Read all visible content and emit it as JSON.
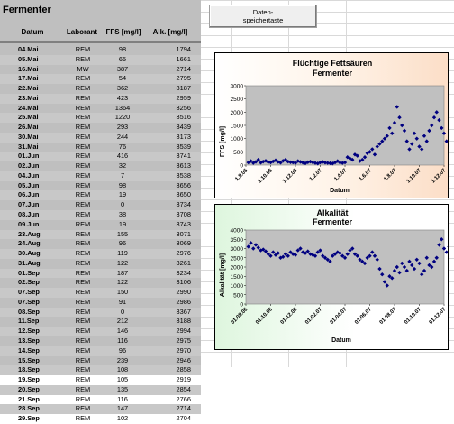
{
  "sheet": {
    "title": "Fermenter",
    "columns": [
      "Datum",
      "Laborant",
      "FFS [mg/l]",
      "Alk. [mg/l]"
    ],
    "rows": [
      [
        "04.Mai",
        "REM",
        "98",
        "1794"
      ],
      [
        "05.Mai",
        "REM",
        "65",
        "1661"
      ],
      [
        "16.Mai",
        "MW",
        "387",
        "2714"
      ],
      [
        "17.Mai",
        "REM",
        "54",
        "2795"
      ],
      [
        "22.Mai",
        "REM",
        "362",
        "3187"
      ],
      [
        "23.Mai",
        "REM",
        "423",
        "2959"
      ],
      [
        "24.Mai",
        "REM",
        "1364",
        "3256"
      ],
      [
        "25.Mai",
        "REM",
        "1220",
        "3516"
      ],
      [
        "26.Mai",
        "REM",
        "293",
        "3439"
      ],
      [
        "30.Mai",
        "REM",
        "244",
        "3173"
      ],
      [
        "31.Mai",
        "REM",
        "76",
        "3539"
      ],
      [
        "01.Jun",
        "REM",
        "416",
        "3741"
      ],
      [
        "02.Jun",
        "REM",
        "32",
        "3613"
      ],
      [
        "04.Jun",
        "REM",
        "7",
        "3538"
      ],
      [
        "05.Jun",
        "REM",
        "98",
        "3656"
      ],
      [
        "06.Jun",
        "REM",
        "19",
        "3650"
      ],
      [
        "07.Jun",
        "REM",
        "0",
        "3734"
      ],
      [
        "08.Jun",
        "REM",
        "38",
        "3708"
      ],
      [
        "09.Jun",
        "REM",
        "19",
        "3743"
      ],
      [
        "23.Aug",
        "REM",
        "155",
        "3071"
      ],
      [
        "24.Aug",
        "REM",
        "96",
        "3069"
      ],
      [
        "30.Aug",
        "REM",
        "119",
        "2976"
      ],
      [
        "31.Aug",
        "REM",
        "122",
        "3261"
      ],
      [
        "01.Sep",
        "REM",
        "187",
        "3234"
      ],
      [
        "02.Sep",
        "REM",
        "122",
        "3106"
      ],
      [
        "07.Sep",
        "REM",
        "150",
        "2990"
      ],
      [
        "07.Sep",
        "REM",
        "91",
        "2986"
      ],
      [
        "08.Sep",
        "REM",
        "0",
        "3367"
      ],
      [
        "11.Sep",
        "REM",
        "212",
        "3188"
      ],
      [
        "12.Sep",
        "REM",
        "146",
        "2994"
      ],
      [
        "13.Sep",
        "REM",
        "116",
        "2975"
      ],
      [
        "14.Sep",
        "REM",
        "96",
        "2970"
      ],
      [
        "15.Sep",
        "REM",
        "239",
        "2946"
      ],
      [
        "18.Sep",
        "REM",
        "108",
        "2858"
      ],
      [
        "19.Sep",
        "REM",
        "105",
        "2919"
      ],
      [
        "20.Sep",
        "REM",
        "135",
        "2854"
      ],
      [
        "21.Sep",
        "REM",
        "116",
        "2766"
      ],
      [
        "28.Sep",
        "REM",
        "147",
        "2714"
      ],
      [
        "29.Sep",
        "REM",
        "102",
        "2704"
      ]
    ]
  },
  "button": {
    "line1": "Daten-",
    "line2": "speichertaste"
  },
  "chart_data": [
    {
      "type": "scatter",
      "title": "Flüchtige Fettsäuren",
      "subtitle": "Fermenter",
      "ylabel": "FFS [mg/l]",
      "xlabel": "Datum",
      "ylim": [
        0,
        3000
      ],
      "yticks": [
        0,
        500,
        1000,
        1500,
        2000,
        2500,
        3000
      ],
      "xticks": [
        "1.8.06",
        "1.10.06",
        "1.12.06",
        "1.2.07",
        "1.4.07",
        "1.6.07",
        "1.8.07",
        "1.10.07",
        "1.12.07"
      ],
      "marker_color": "#000080",
      "background": "#c0c0c0",
      "x": [
        0.1,
        0.2,
        0.3,
        0.4,
        0.5,
        0.6,
        0.7,
        0.8,
        0.9,
        1.0,
        1.1,
        1.2,
        1.3,
        1.4,
        1.5,
        1.6,
        1.7,
        1.8,
        1.9,
        2.0,
        2.1,
        2.2,
        2.3,
        2.4,
        2.5,
        2.6,
        2.7,
        2.8,
        2.9,
        3.0,
        3.1,
        3.2,
        3.3,
        3.4,
        3.5,
        3.6,
        3.7,
        3.8,
        3.9,
        4.0,
        4.1,
        4.2,
        4.3,
        4.4,
        4.5,
        4.6,
        4.7,
        4.8,
        4.9,
        5.0,
        5.1,
        5.2,
        5.3,
        5.4,
        5.5,
        5.6,
        5.7,
        5.8,
        5.9,
        6.0,
        6.1,
        6.2,
        6.3,
        6.4,
        6.5,
        6.6,
        6.7,
        6.8,
        6.9,
        7.0,
        7.1,
        7.2,
        7.3,
        7.4,
        7.5,
        7.6,
        7.7,
        7.8,
        7.9,
        8.0,
        8.1,
        8.2,
        8.3
      ],
      "y": [
        100,
        150,
        80,
        120,
        200,
        90,
        130,
        160,
        110,
        100,
        140,
        180,
        120,
        90,
        160,
        200,
        130,
        110,
        100,
        80,
        150,
        120,
        90,
        70,
        110,
        130,
        100,
        80,
        60,
        100,
        120,
        90,
        80,
        70,
        60,
        100,
        150,
        90,
        80,
        100,
        300,
        250,
        200,
        400,
        350,
        150,
        200,
        300,
        450,
        500,
        600,
        400,
        700,
        800,
        900,
        1000,
        1100,
        1400,
        1200,
        1600,
        2200,
        1800,
        1500,
        1300,
        900,
        600,
        800,
        1200,
        1000,
        700,
        600,
        1100,
        900,
        1300,
        1500,
        1800,
        2000,
        1700,
        1400,
        1200,
        900,
        500,
        300
      ],
      "xaxis_unit": "months since 1.8.06"
    },
    {
      "type": "scatter",
      "title": "Alkalität",
      "subtitle": "Fermenter",
      "ylabel": "Alkalität [mg/l]",
      "xlabel": "Datum",
      "ylim": [
        0,
        4000
      ],
      "yticks": [
        0,
        500,
        1000,
        1500,
        2000,
        2500,
        3000,
        3500,
        4000
      ],
      "xticks": [
        "01.08.06",
        "01.10.06",
        "01.12.06",
        "01.02.07",
        "01.04.07",
        "01.06.07",
        "01.08.07",
        "01.10.07",
        "01.12.07"
      ],
      "marker_color": "#000080",
      "background": "#c0c0c0",
      "x": [
        0.1,
        0.2,
        0.3,
        0.4,
        0.5,
        0.6,
        0.7,
        0.8,
        0.9,
        1.0,
        1.1,
        1.2,
        1.3,
        1.4,
        1.5,
        1.6,
        1.7,
        1.8,
        1.9,
        2.0,
        2.1,
        2.2,
        2.3,
        2.4,
        2.5,
        2.6,
        2.7,
        2.8,
        2.9,
        3.0,
        3.1,
        3.2,
        3.3,
        3.4,
        3.5,
        3.6,
        3.7,
        3.8,
        3.9,
        4.0,
        4.1,
        4.2,
        4.3,
        4.4,
        4.5,
        4.6,
        4.7,
        4.8,
        4.9,
        5.0,
        5.1,
        5.2,
        5.3,
        5.4,
        5.5,
        5.6,
        5.7,
        5.8,
        5.9,
        6.0,
        6.1,
        6.2,
        6.3,
        6.4,
        6.5,
        6.6,
        6.7,
        6.8,
        6.9,
        7.0,
        7.1,
        7.2,
        7.3,
        7.4,
        7.5,
        7.6,
        7.7,
        7.8,
        7.9,
        8.0,
        8.1,
        8.2,
        8.3
      ],
      "y": [
        3100,
        3300,
        3000,
        3200,
        3050,
        2900,
        2950,
        2850,
        2700,
        2600,
        2800,
        2650,
        2750,
        2500,
        2550,
        2700,
        2600,
        2800,
        2700,
        2650,
        2900,
        3000,
        2800,
        2750,
        2850,
        2700,
        2650,
        2600,
        2800,
        2900,
        2600,
        2500,
        2400,
        2300,
        2600,
        2700,
        2800,
        2750,
        2600,
        2500,
        2700,
        2900,
        3000,
        2700,
        2600,
        2400,
        2300,
        2200,
        2500,
        2600,
        2800,
        2600,
        2400,
        1900,
        1600,
        1200,
        1000,
        1500,
        1400,
        1800,
        2000,
        1700,
        2200,
        2000,
        1800,
        2300,
        2100,
        1900,
        2400,
        2200,
        1600,
        1800,
        2500,
        2100,
        2000,
        2300,
        2500,
        3200,
        3500,
        3000,
        2800,
        3100,
        3300
      ],
      "xaxis_unit": "months since 01.08.06"
    }
  ]
}
